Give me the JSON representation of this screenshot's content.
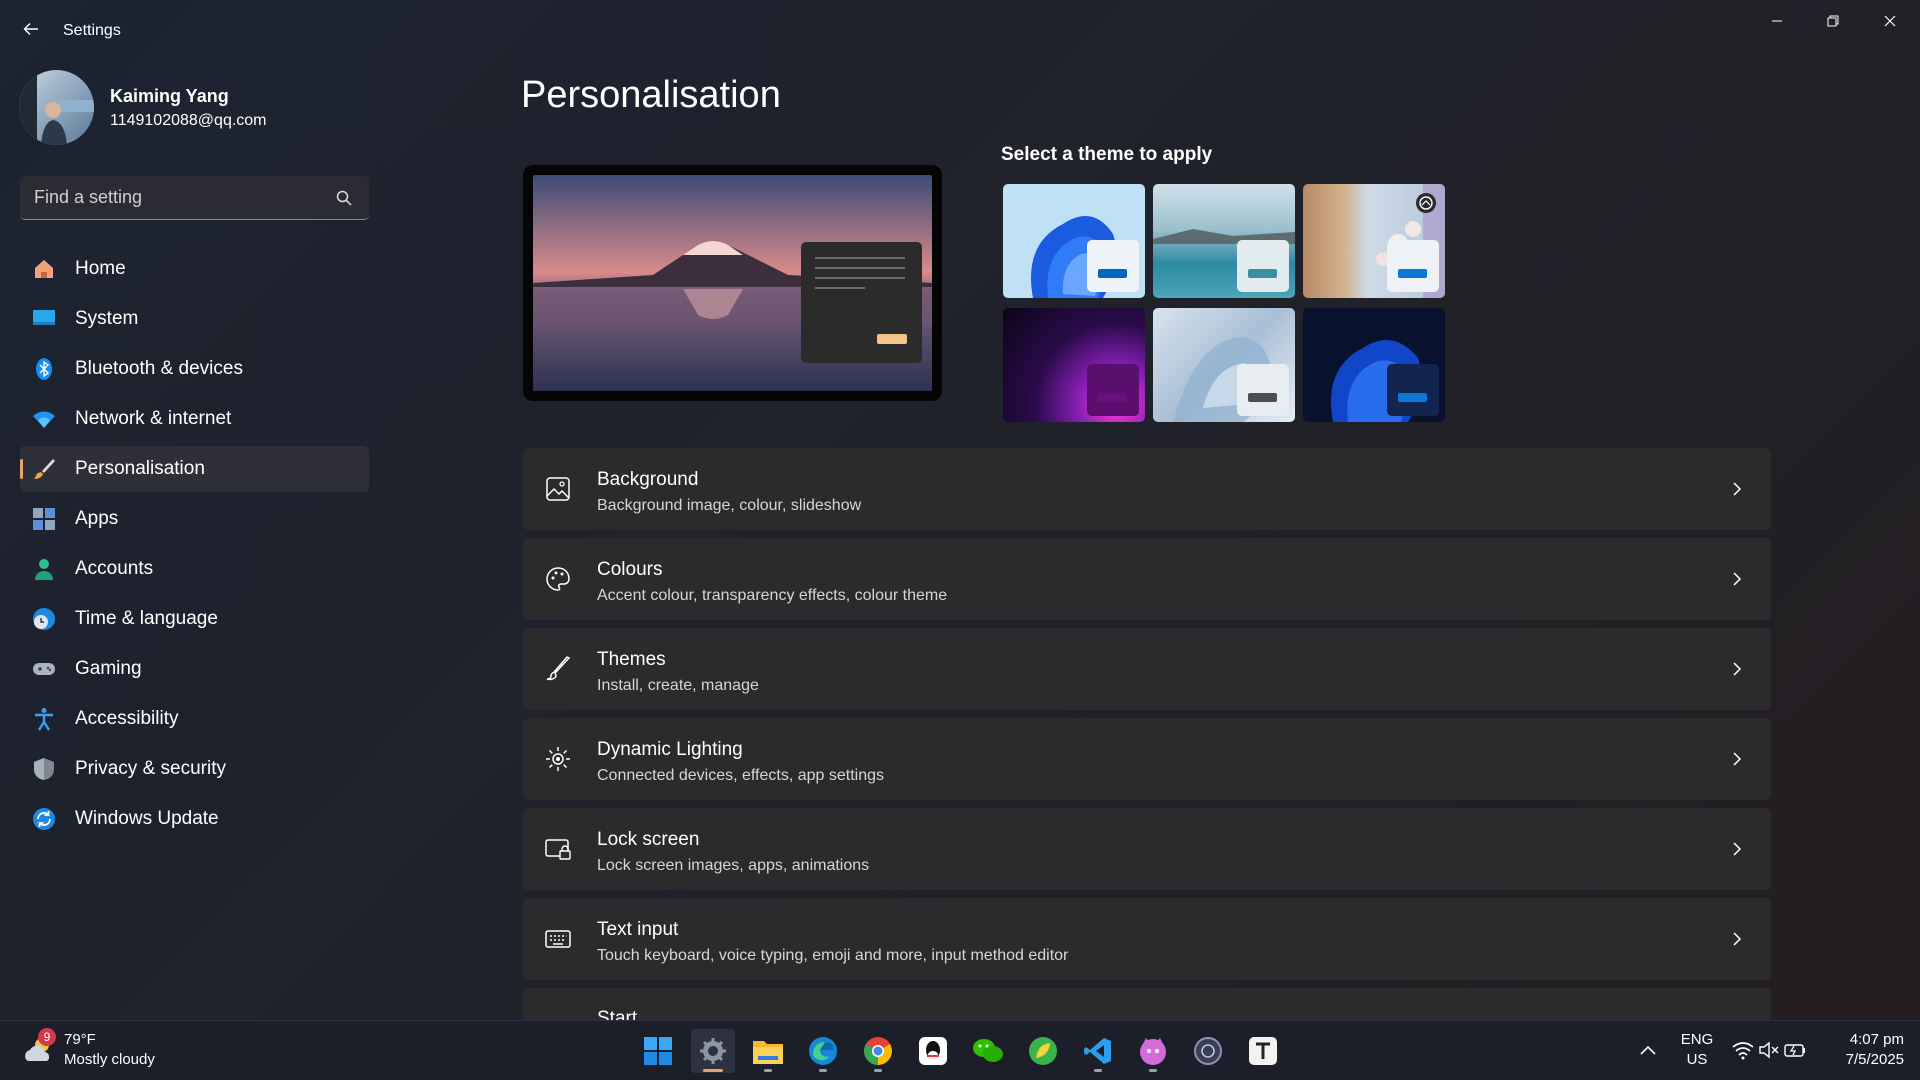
{
  "window": {
    "title": "Settings",
    "controls": [
      "minimize",
      "restore",
      "close"
    ]
  },
  "profile": {
    "name": "Kaiming Yang",
    "email": "1149102088@qq.com"
  },
  "search": {
    "placeholder": "Find a setting"
  },
  "sidebar": {
    "items": [
      {
        "label": "Home",
        "icon": "home-icon"
      },
      {
        "label": "System",
        "icon": "monitor-icon"
      },
      {
        "label": "Bluetooth & devices",
        "icon": "bluetooth-icon"
      },
      {
        "label": "Network & internet",
        "icon": "wifi-icon"
      },
      {
        "label": "Personalisation",
        "icon": "brush-icon",
        "active": true
      },
      {
        "label": "Apps",
        "icon": "apps-icon"
      },
      {
        "label": "Accounts",
        "icon": "person-icon"
      },
      {
        "label": "Time & language",
        "icon": "globe-clock-icon"
      },
      {
        "label": "Gaming",
        "icon": "gamepad-icon"
      },
      {
        "label": "Accessibility",
        "icon": "accessibility-icon"
      },
      {
        "label": "Privacy & security",
        "icon": "shield-icon"
      },
      {
        "label": "Windows Update",
        "icon": "refresh-icon"
      }
    ]
  },
  "main": {
    "title": "Personalisation",
    "theme_heading": "Select a theme to apply",
    "themes": [
      {
        "name": "windows-light",
        "accent": "#0067c0"
      },
      {
        "name": "glow-lake",
        "accent": "#3a8fa0"
      },
      {
        "name": "captured-motion-flowers",
        "accent": "#0a78d4",
        "badge_icon": "spotlight-icon"
      },
      {
        "name": "sunrise-purple",
        "accent": "#6a0f7e"
      },
      {
        "name": "flow-light",
        "accent": "#4a4f57"
      },
      {
        "name": "windows-dark",
        "accent": "#0a78d4"
      }
    ],
    "settings": [
      {
        "title": "Background",
        "desc": "Background image, colour, slideshow",
        "icon": "picture-icon"
      },
      {
        "title": "Colours",
        "desc": "Accent colour, transparency effects, colour theme",
        "icon": "palette-icon"
      },
      {
        "title": "Themes",
        "desc": "Install, create, manage",
        "icon": "brush-icon"
      },
      {
        "title": "Dynamic Lighting",
        "desc": "Connected devices, effects, app settings",
        "icon": "sun-icon"
      },
      {
        "title": "Lock screen",
        "desc": "Lock screen images, apps, animations",
        "icon": "lock-screen-icon"
      },
      {
        "title": "Text input",
        "desc": "Touch keyboard, voice typing, emoji and more, input method editor",
        "icon": "keyboard-icon"
      },
      {
        "title": "Start",
        "desc": "",
        "icon": ""
      }
    ]
  },
  "taskbar": {
    "weather": {
      "temp": "79°F",
      "desc": "Mostly cloudy",
      "badge": "9"
    },
    "apps": [
      "start",
      "settings",
      "file-explorer",
      "edge",
      "chrome",
      "qq",
      "wechat",
      "app-green",
      "vscode",
      "app-cat",
      "app-circle",
      "typora"
    ],
    "language": {
      "line1": "ENG",
      "line2": "US"
    },
    "clock": {
      "time": "4:07 pm",
      "date": "7/5/2025"
    }
  },
  "colors": {
    "accent": "#e8a26c",
    "card_bg": "#2b2b2e",
    "window_bg": "#20222b"
  }
}
